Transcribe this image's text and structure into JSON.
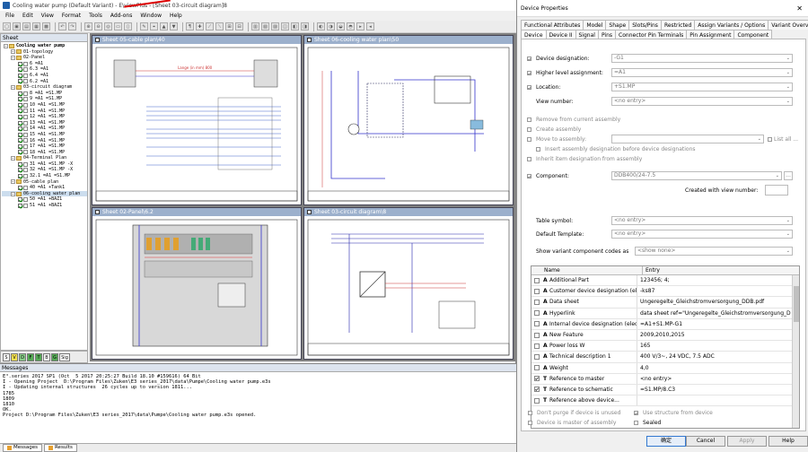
{
  "app": {
    "title": "Cooling water pump (Default Variant) - E\\viewPlus - [Sheet 03-circuit diagram]8",
    "menu": [
      "File",
      "Edit",
      "View",
      "Format",
      "Tools",
      "Add-ons",
      "Window",
      "Help"
    ]
  },
  "sheet_panel": {
    "title": "Sheet",
    "tree": [
      {
        "level": 0,
        "label": "Sheet",
        "type": "header"
      },
      {
        "level": 0,
        "label": "Cooling water pump",
        "type": "root"
      },
      {
        "level": 1,
        "label": "01-topology",
        "type": "folder"
      },
      {
        "level": 1,
        "label": "02-Panel",
        "type": "folder"
      },
      {
        "level": 2,
        "label": "6 =A1",
        "type": "sheet",
        "checked": true
      },
      {
        "level": 2,
        "label": "6.3 =A1",
        "type": "sheet",
        "checked": true
      },
      {
        "level": 2,
        "label": "6.4 =A1",
        "type": "sheet",
        "checked": true
      },
      {
        "level": 2,
        "label": "6.2 =A1",
        "type": "sheet",
        "checked": true
      },
      {
        "level": 1,
        "label": "03-circuit diagram",
        "type": "folder"
      },
      {
        "level": 2,
        "label": "8 =A1 =S1.MP",
        "type": "sheet",
        "checked": true
      },
      {
        "level": 2,
        "label": "9 =A1 =S1.MP",
        "type": "sheet",
        "checked": true
      },
      {
        "level": 2,
        "label": "10 =A1 =S1.MP",
        "type": "sheet",
        "checked": true
      },
      {
        "level": 2,
        "label": "11 =A1 =S1.MP",
        "type": "sheet",
        "checked": true
      },
      {
        "level": 2,
        "label": "12 =A1 =S1.MP",
        "type": "sheet",
        "checked": true
      },
      {
        "level": 2,
        "label": "13 =A1 =S1.MP",
        "type": "sheet",
        "checked": true
      },
      {
        "level": 2,
        "label": "14 =A1 =S1.MP",
        "type": "sheet",
        "checked": true
      },
      {
        "level": 2,
        "label": "15 =A1 =S1.MP",
        "type": "sheet",
        "checked": true
      },
      {
        "level": 2,
        "label": "16 =A1 =S1.MP",
        "type": "sheet",
        "checked": true
      },
      {
        "level": 2,
        "label": "17 =A1 =S1.MP",
        "type": "sheet",
        "checked": true
      },
      {
        "level": 2,
        "label": "18 =A1 =S1.MP",
        "type": "sheet",
        "checked": true
      },
      {
        "level": 1,
        "label": "04-Terminal Plan",
        "type": "folder"
      },
      {
        "level": 2,
        "label": "31 =A1 =S1.MP -X",
        "type": "sheet",
        "checked": true
      },
      {
        "level": 2,
        "label": "32 =A1 =S1.MP -X",
        "type": "sheet",
        "checked": true
      },
      {
        "level": 2,
        "label": "32.1 =A1 =S1.MP",
        "type": "sheet",
        "checked": true
      },
      {
        "level": 1,
        "label": "05-cable plan",
        "type": "folder"
      },
      {
        "level": 2,
        "label": "40 =A1 +Tank1",
        "type": "sheet",
        "checked": true
      },
      {
        "level": 1,
        "label": "06-cooling water plan",
        "type": "folder",
        "selected": true
      },
      {
        "level": 2,
        "label": "50 =A1 +BAZ1",
        "type": "sheet",
        "checked": true
      },
      {
        "level": 2,
        "label": "51 =A1 +BAZ1",
        "type": "sheet",
        "checked": true
      }
    ],
    "bottom_tabs": [
      "S",
      "V",
      "D",
      "F",
      "T",
      "B",
      "G",
      "Sig"
    ]
  },
  "sheets": {
    "w1": "Sheet 05-cable plan\\40",
    "w2": "Sheet 06-cooling water plan\\50",
    "w3": "Sheet 02-Panel\\6.2",
    "w4": "Sheet 03-circuit diagram\\8",
    "cable_label": "Lange (in mm) 800"
  },
  "messages": {
    "title": "Messages",
    "lines": [
      "E³.series 2017 SP1 (Oct  5 2017 20:25:27 Build 18.10 #159616) 64 Bit",
      "I - Opening Project  D:\\Program Files\\Zuken\\E3 series_2017\\data\\Pumpe\\Cooling water pump.e3s",
      "I - Updating internal structures  26 cycles up to version 1811...",
      "1785",
      "1809",
      "1810",
      "OK.",
      "Project D:\\Program Files\\Zuken\\E3 series_2017\\data\\Pumpe\\Cooling water pump.e3s opened."
    ],
    "tabs": [
      "Messages",
      "Results"
    ]
  },
  "dialog": {
    "title": "Device Properties",
    "tabs_row1": [
      "Functional Attributes",
      "Model",
      "Shape",
      "Slots/Pins",
      "Restricted",
      "Assign Variants / Options",
      "Variant Overview"
    ],
    "tabs_row2": [
      "Device",
      "Device II",
      "Signal",
      "Pins",
      "Connector Pin Terminals",
      "Pin Assignment",
      "Component"
    ],
    "device_designation_label": "Device designation:",
    "device_designation": "-G1",
    "higher_level_label": "Higher level assignment:",
    "higher_level": "=A1",
    "location_label": "Location:",
    "location": "+S1.MP",
    "view_number_label": "View number:",
    "view_number": "<no entry>",
    "remove_assembly": "Remove from current assembly",
    "create_assembly": "Create assembly",
    "move_assembly": "Move to assembly:",
    "list_all": "List all ...",
    "insert_assembly": "Insert assembly designation before device designations",
    "inherit_item": "Inherit item designation from assembly",
    "component_label": "Component:",
    "component": "DDB400/24-7.5",
    "created_view_label": "Created with view number:",
    "table_symbol_label": "Table symbol:",
    "table_symbol": "<no entry>",
    "default_template_label": "Default Template:",
    "default_template": "<no entry>",
    "show_variant_label": "Show variant component codes as",
    "show_variant": "<show none>",
    "grid_head_name": "Name",
    "grid_head_entry": "Entry",
    "attributes": [
      {
        "type": "A",
        "name": "Additional Part",
        "entry": "123456; 4;",
        "checked": false
      },
      {
        "type": "A",
        "name": "Customer device designation (el...",
        "entry": "-ks87",
        "checked": false
      },
      {
        "type": "A",
        "name": "Data sheet",
        "entry": "Ungeregelte_Gleichstromversorgung_DDB.pdf",
        "checked": false
      },
      {
        "type": "A",
        "name": "Hyperlink",
        "entry": "data sheet ref=\"Ungeregelte_Gleichstromversorgung_D",
        "checked": false
      },
      {
        "type": "A",
        "name": "Internal device designation (elec...",
        "entry": "=A1+S1.MP-G1",
        "checked": false
      },
      {
        "type": "A",
        "name": "New Feature",
        "entry": "2009,2010,2015",
        "checked": false
      },
      {
        "type": "A",
        "name": "Power loss W",
        "entry": "165",
        "checked": false
      },
      {
        "type": "A",
        "name": "Technical description 1",
        "entry": "400 V/3~, 24 VDC, 7.5 ADC",
        "checked": false
      },
      {
        "type": "A",
        "name": "Weight",
        "entry": "4,0",
        "checked": false
      },
      {
        "type": "T",
        "name": "Reference to master",
        "entry": "<no entry>",
        "checked": true
      },
      {
        "type": "T",
        "name": "Reference to schematic",
        "entry": "=S1.MP/8.C3",
        "checked": true
      },
      {
        "type": "T",
        "name": "Reference above device...",
        "entry": "",
        "checked": false
      }
    ],
    "dont_purge": "Don't purge if device is unused",
    "use_structure": "Use structure from device",
    "device_master": "Device is master of assembly",
    "sealed": "Sealed",
    "ok": "确定",
    "cancel": "Cancel",
    "apply": "Apply",
    "help": "Help"
  }
}
